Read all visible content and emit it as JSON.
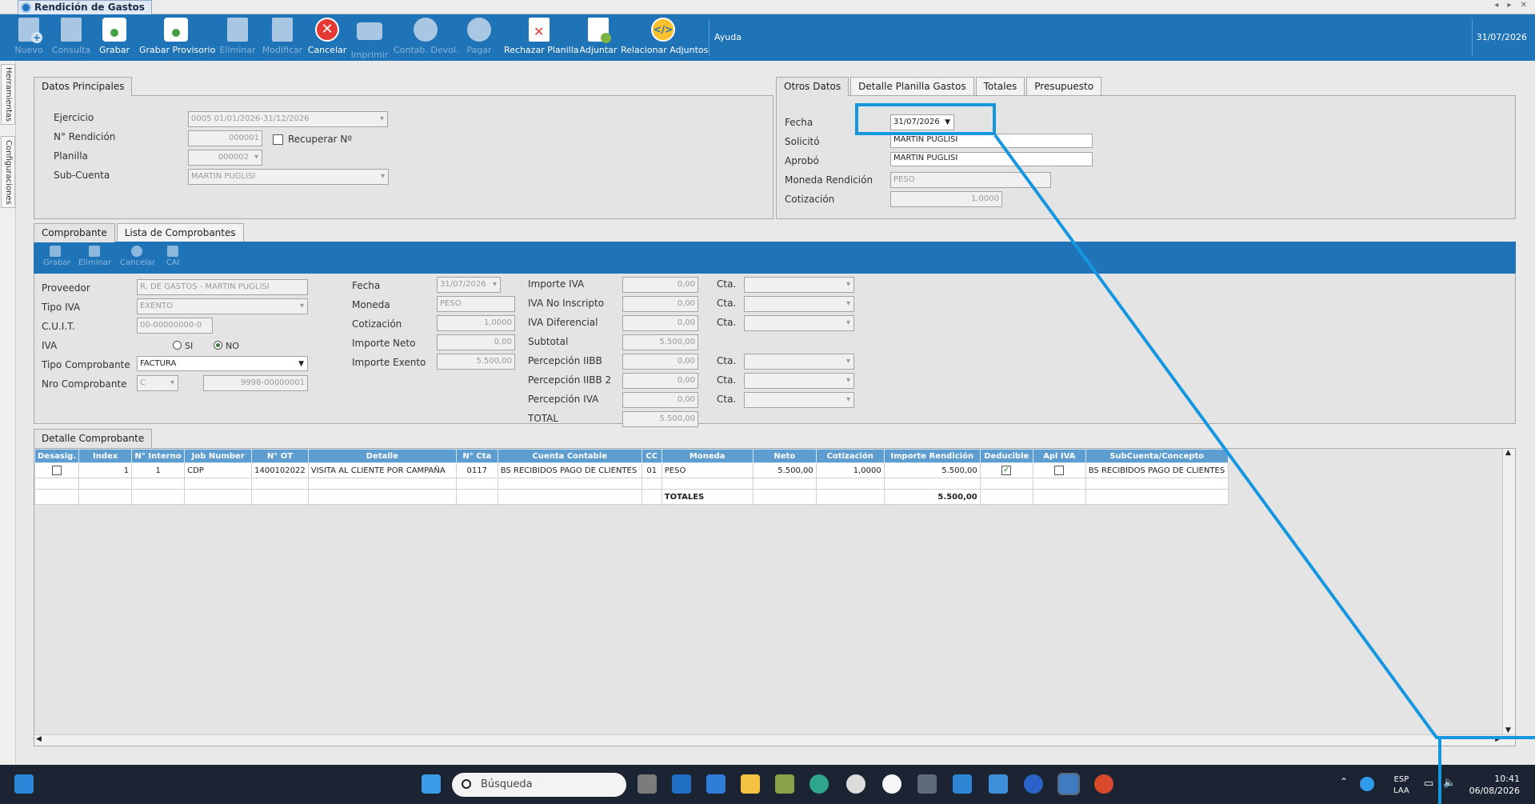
{
  "window": {
    "tab_title": "Rendición de Gastos",
    "nav_arrows": "◂ ▸ ✕"
  },
  "toolbar": {
    "buttons": [
      {
        "label": "Nuevo",
        "icon": "new-doc-icon",
        "enabled": false
      },
      {
        "label": "Consulta",
        "icon": "query-doc-icon",
        "enabled": false
      },
      {
        "label": "Grabar",
        "icon": "save-icon",
        "enabled": true
      },
      {
        "label": "Grabar Provisorio",
        "icon": "save-draft-icon",
        "enabled": true
      },
      {
        "label": "Eliminar",
        "icon": "delete-doc-icon",
        "enabled": false
      },
      {
        "label": "Modificar",
        "icon": "edit-doc-icon",
        "enabled": false
      },
      {
        "label": "Cancelar",
        "icon": "cancel-icon",
        "enabled": true
      },
      {
        "label": "Imprimir",
        "icon": "printer-icon",
        "enabled": false
      },
      {
        "label": "Contab. Devol.",
        "icon": "accounting-return-icon",
        "enabled": false
      },
      {
        "label": "Pagar",
        "icon": "pay-icon",
        "enabled": false
      },
      {
        "label": "Rechazar Planilla",
        "icon": "reject-sheet-icon",
        "enabled": true
      },
      {
        "label": "Adjuntar",
        "icon": "attach-icon",
        "enabled": true
      },
      {
        "label": "Relacionar Adjuntos",
        "icon": "link-attachments-icon",
        "enabled": true
      }
    ],
    "help_label": "Ayuda",
    "date": "31/07/2026"
  },
  "rail": {
    "tools": "Herramientas",
    "config": "Configuraciones"
  },
  "datos_principales": {
    "tab": "Datos Principales",
    "ejercicio_label": "Ejercicio",
    "ejercicio_value": "0005 01/01/2026-31/12/2026",
    "rendicion_label": "N° Rendición",
    "rendicion_value": "000001",
    "recuperar_label": "Recuperar Nº",
    "planilla_label": "Planilla",
    "planilla_value": "000002",
    "subcuenta_label": "Sub-Cuenta",
    "subcuenta_value": "MARTIN PUGLISI"
  },
  "otros_datos": {
    "tabs": [
      "Otros Datos",
      "Detalle Planilla Gastos",
      "Totales",
      "Presupuesto"
    ],
    "fecha_label": "Fecha",
    "fecha_value": "31/07/2026",
    "solicito_label": "Solicitó",
    "solicito_value": "MARTIN PUGLISI",
    "aprobo_label": "Aprobó",
    "aprobo_value": "MARTIN PUGLISI",
    "moneda_label": "Moneda Rendición",
    "moneda_value": "PESO",
    "cotizacion_label": "Cotización",
    "cotizacion_value": "1,0000"
  },
  "comprobante": {
    "tabs": [
      "Comprobante",
      "Lista de Comprobantes"
    ],
    "subtoolbar": [
      "Grabar",
      "Eliminar",
      "Cancelar",
      "CAI"
    ],
    "proveedor_label": "Proveedor",
    "proveedor_value": "R. DE GASTOS - MARTIN PUGLISI",
    "tipoiva_label": "Tipo IVA",
    "tipoiva_value": "EXENTO",
    "cuit_label": "C.U.I.T.",
    "cuit_value": "00-00000000-0",
    "iva_label": "IVA",
    "iva_si": "SI",
    "iva_no": "NO",
    "tipocomp_label": "Tipo Comprobante",
    "tipocomp_value": "FACTURA",
    "nrocomp_label": "Nro Comprobante",
    "nrocomp_letter": "C",
    "nrocomp_value": "9998-00000001",
    "fecha_label": "Fecha",
    "fecha_value": "31/07/2026",
    "moneda_label": "Moneda",
    "moneda_value": "PESO",
    "cotizacion_label": "Cotización",
    "cotizacion_value": "1,0000",
    "neto_label": "Importe Neto",
    "neto_value": "0,00",
    "exento_label": "Importe Exento",
    "exento_value": "5.500,00",
    "imp_iva_label": "Importe IVA",
    "imp_iva_value": "0,00",
    "iva_noinsc_label": "IVA No Inscripto",
    "iva_noinsc_value": "0,00",
    "iva_dif_label": "IVA Diferencial",
    "iva_dif_value": "0,00",
    "subtotal_label": "Subtotal",
    "subtotal_value": "5.500,00",
    "perc_iibb_label": "Percepción IIBB",
    "perc_iibb_value": "0,00",
    "perc_iibb2_label": "Percepción IIBB 2",
    "perc_iibb2_value": "0,00",
    "perc_iva_label": "Percepción IVA",
    "perc_iva_value": "0,00",
    "total_label": "TOTAL",
    "total_value": "5.500,00",
    "cta_label": "Cta."
  },
  "detalle": {
    "tab": "Detalle Comprobante",
    "columns": [
      "Desasig.",
      "Index",
      "N° Interno",
      "Job Number",
      "N° OT",
      "Detalle",
      "N° Cta",
      "Cuenta Contable",
      "CC",
      "Moneda",
      "Neto",
      "Cotización",
      "Importe Rendición",
      "Deducible",
      "Apl IVA",
      "SubCuenta/Concepto"
    ],
    "row": {
      "index": "1",
      "interno": "1",
      "job": "CDP",
      "ot": "1400102022",
      "detalle": "VISITA AL CLIENTE POR CAMPAÑA",
      "cta": "0117",
      "cuenta": "BS RECIBIDOS PAGO DE CLIENTES",
      "cc": "01",
      "moneda": "PESO",
      "neto": "5.500,00",
      "cotizacion": "1,0000",
      "importe": "5.500,00",
      "subcuenta": "BS RECIBIDOS PAGO DE CLIENTES"
    },
    "totals_label": "TOTALES",
    "totals_value": "5.500,00"
  },
  "taskbar": {
    "search_placeholder": "Búsqueda",
    "lang": "ESP",
    "lang2": "LAA",
    "time": "10:41",
    "date": "06/08/2026"
  }
}
